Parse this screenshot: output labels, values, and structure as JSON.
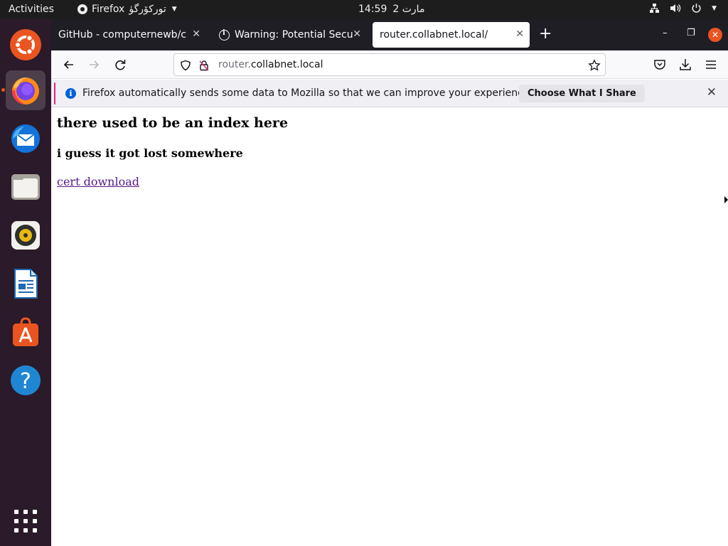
{
  "topbar": {
    "activities": "Activities",
    "app_name": "Firefox",
    "app_menu_suffix": "توركۆرگۈ",
    "date": "مارت 2",
    "time": "14:59"
  },
  "dock": {
    "items": [
      {
        "name": "ubuntu-icon",
        "active": false
      },
      {
        "name": "firefox-icon",
        "active": true
      },
      {
        "name": "thunderbird-icon",
        "active": false
      },
      {
        "name": "files-icon",
        "active": false
      },
      {
        "name": "rhythmbox-icon",
        "active": false
      },
      {
        "name": "libreoffice-writer-icon",
        "active": false
      },
      {
        "name": "software-center-icon",
        "active": false
      },
      {
        "name": "help-icon",
        "active": false
      },
      {
        "name": "app-grid-icon",
        "active": false
      }
    ]
  },
  "browser": {
    "tabs": [
      {
        "label": "GitHub - computernewb/coll"
      },
      {
        "label": "Warning: Potential Securi"
      },
      {
        "label": "router.collabnet.local/",
        "selected": true
      }
    ],
    "url_prefix": "router.",
    "url_domain": "collabnet.local",
    "notification": {
      "message": "Firefox automatically sends some data to Mozilla so that we can improve your experience.",
      "button": "Choose What I Share"
    }
  },
  "page": {
    "heading": "there used to be an index here",
    "subheading": "i guess it got lost somewhere",
    "link_text": "cert download"
  },
  "colors": {
    "accent": "#e95420",
    "dock_bg": "#2b1a29",
    "link_visited": "#551a8b"
  }
}
